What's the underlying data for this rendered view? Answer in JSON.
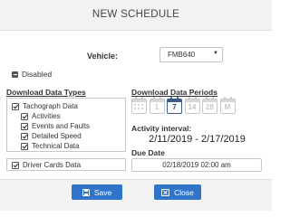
{
  "header": {
    "title": "NEW SCHEDULE"
  },
  "vehicle": {
    "label": "Vehicle:",
    "selected": "FMB640"
  },
  "status": {
    "label": "Disabled"
  },
  "download_types": {
    "title": "Download Data Types",
    "tachograph": {
      "label": "Tachograph Data",
      "children": [
        "Activities",
        "Events and Faults",
        "Detailed Speed",
        "Technical Data"
      ]
    },
    "driver_cards_label": "Driver Cards Data"
  },
  "download_periods": {
    "title": "Download Data Periods",
    "options": [
      "1",
      "7",
      "14",
      "28",
      "M"
    ],
    "selected": "7"
  },
  "activity": {
    "label": "Activity interval:",
    "value": "2/11/2019 - 2/17/2019"
  },
  "due": {
    "label": "Due Date",
    "value": "02/18/2019 02:00 am"
  },
  "actions": {
    "save_label": "Save",
    "close_label": "Close"
  },
  "colors": {
    "primary": "#2f74c9",
    "selected_period": "#3a5d8c"
  }
}
